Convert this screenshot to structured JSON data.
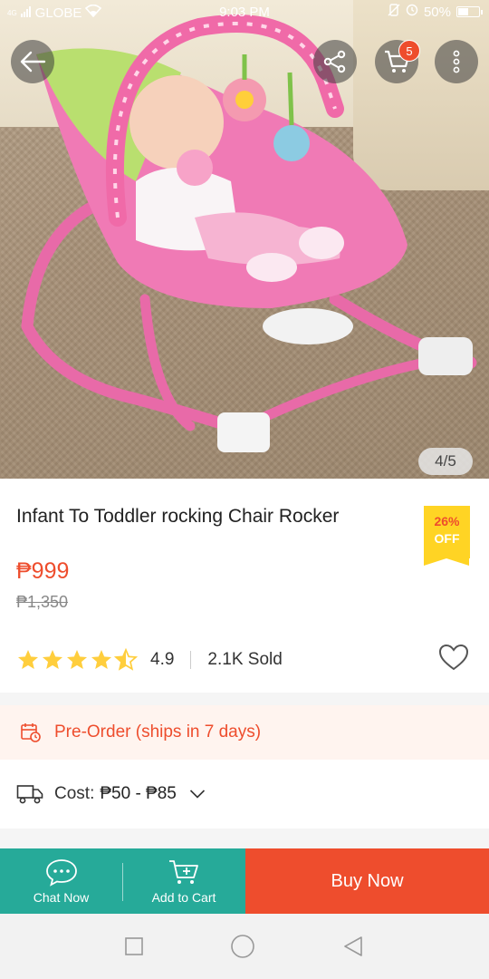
{
  "status_bar": {
    "network_type": "4G",
    "carrier": "GLOBE",
    "time": "9:03 PM",
    "battery_percent": "50%",
    "battery_level": 0.5
  },
  "hero": {
    "image_counter": "4/5",
    "cart_count": "5",
    "icons": [
      "back-arrow-icon",
      "share-icon",
      "cart-icon",
      "more-vertical-icon"
    ]
  },
  "product": {
    "title": "Infant To Toddler rocking Chair Rocker",
    "discount_percent": "26%",
    "discount_suffix": "OFF",
    "price": "₱999",
    "original_price": "₱1,350",
    "rating": "4.9",
    "rating_stars": 4.5,
    "sold": "2.1K Sold"
  },
  "preorder": {
    "text": "Pre-Order (ships in 7 days)"
  },
  "shipping": {
    "label": "Cost:",
    "value": "₱50 - ₱85"
  },
  "actions": {
    "chat_label": "Chat Now",
    "cart_label": "Add to Cart",
    "buy_label": "Buy Now"
  },
  "colors": {
    "accent": "#ee4d2d",
    "teal": "#26aa99",
    "star": "#ffce3d",
    "badge_yellow": "#ffd424"
  }
}
